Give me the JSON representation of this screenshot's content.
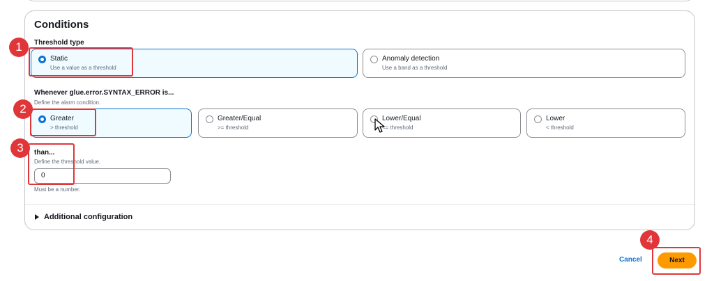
{
  "conditions": {
    "title": "Conditions",
    "threshold_type": {
      "label": "Threshold type",
      "options": [
        {
          "label": "Static",
          "sub": "Use a value as a threshold",
          "selected": true
        },
        {
          "label": "Anomaly detection",
          "sub": "Use a band as a threshold",
          "selected": false
        }
      ]
    },
    "whenever": {
      "label": "Whenever glue.error.SYNTAX_ERROR is...",
      "desc": "Define the alarm condition.",
      "options": [
        {
          "label": "Greater",
          "sub": "> threshold",
          "selected": true
        },
        {
          "label": "Greater/Equal",
          "sub": ">= threshold",
          "selected": false
        },
        {
          "label": "Lower/Equal",
          "sub": "<= threshold",
          "selected": false
        },
        {
          "label": "Lower",
          "sub": "< threshold",
          "selected": false
        }
      ]
    },
    "than": {
      "label": "than...",
      "desc": "Define the threshold value.",
      "value": "0",
      "hint": "Must be a number."
    },
    "additional": {
      "label": "Additional configuration"
    }
  },
  "footer": {
    "cancel": "Cancel",
    "next": "Next"
  },
  "annotations": {
    "badges": [
      "1",
      "2",
      "3",
      "4"
    ],
    "color": "#e0363a"
  },
  "colors": {
    "accent": "#0972d3",
    "primary_button": "#ff9900"
  }
}
